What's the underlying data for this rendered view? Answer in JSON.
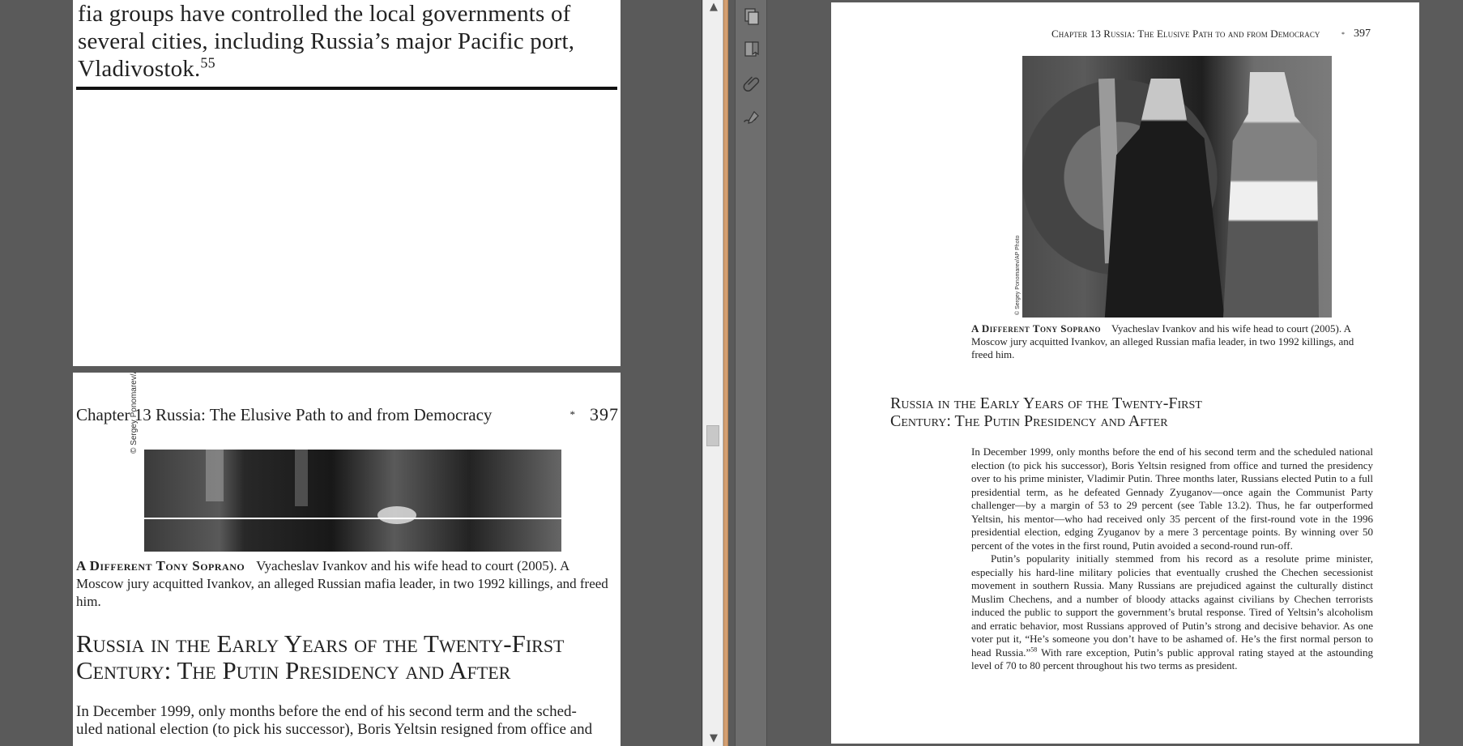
{
  "left_top": {
    "lines": [
      "fia groups have controlled the local governments of",
      "several cities, including Russia’s major Pacific port,",
      "Vladivostok."
    ],
    "footnote": "55"
  },
  "left_bottom": {
    "header_chapter": "Chapter 13   Russia: The Elusive Path to and from Democracy",
    "header_separator": "*",
    "page_number": "397",
    "photo_credit": "© Sergey Ponomarev/AP Photo",
    "caption_title": "A Different Tony Soprano",
    "caption_text": "Vyacheslav Ivankov and his wife head to court (2005). A Moscow jury acquitted Ivankov, an alleged Russian mafia leader, in two 1992 killings, and freed him.",
    "section_title_line1": "Russia in the Early Years of the Twenty-First",
    "section_title_line2": "Century: The Putin Presidency and After",
    "body_line1": "In December 1999, only months before the end of his second term and the sched-",
    "body_line2": "uled national election (to pick his successor), Boris Yeltsin resigned from office and"
  },
  "right_page": {
    "header_chapter": "Chapter 13   Russia: The Elusive Path to and from Democracy",
    "header_separator": "*",
    "page_number": "397",
    "photo_credit": "© Sergey Ponomarev/AP Photo",
    "caption_title": "A Different Tony Soprano",
    "caption_text": "Vyacheslav Ivankov and his wife head to court (2005). A Moscow jury acquitted Ivankov, an alleged Russian mafia leader, in two 1992 killings, and freed him.",
    "section_title_line1": "Russia in the Early Years of the Twenty-First",
    "section_title_line2": "Century: The Putin Presidency and After",
    "paragraph1": "In December 1999, only months before the end of his second term and the scheduled national election (to pick his successor), Boris Yeltsin resigned from office and turned the presidency over to his prime minister, Vladimir Putin. Three months later, Russians elected Putin to a full presidential term, as he defeated Gennady Zyuganov—once again the Communist Party challenger—by a margin of 53 to 29 percent (see Table 13.2). Thus, he far outperformed Yeltsin, his mentor—who had received only 35 percent of the first-round vote in the 1996 presidential election, edging Zyuganov by a mere 3 percentage points. By winning over 50 percent of the votes in the first round, Putin avoided a second-round run-off.",
    "paragraph2_before_note": "Putin’s popularity initially stemmed from his record as a resolute prime minister, especially his hard-line military policies that eventually crushed the Chechen secessionist movement in southern Russia. Many Russians are prejudiced against the culturally distinct Muslim Chechens, and a number of bloody attacks against civilians by Chechen terrorists induced the public to support the government’s brutal response. Tired of Yeltsin’s alcoholism and erratic behavior, most Russians approved of Putin’s strong and decisive behavior. As one voter put it, “He’s someone you don’t have to be ashamed of. He’s the first normal person to head Russia.”",
    "paragraph2_note": "58",
    "paragraph2_after_note": " With rare exception, Putin’s public approval rating stayed at the astounding level of 70 to 80 percent throughout his two terms as president."
  },
  "left_scrollbar": {
    "up_arrow": "▲",
    "down_arrow": "▼"
  },
  "tools": [
    {
      "name": "pages-icon"
    },
    {
      "name": "bookmark-icon"
    },
    {
      "name": "attachment-icon"
    },
    {
      "name": "signature-icon"
    }
  ],
  "colors": {
    "background": "#5a5a5a",
    "page": "#ffffff",
    "separator": "#d39f72"
  }
}
